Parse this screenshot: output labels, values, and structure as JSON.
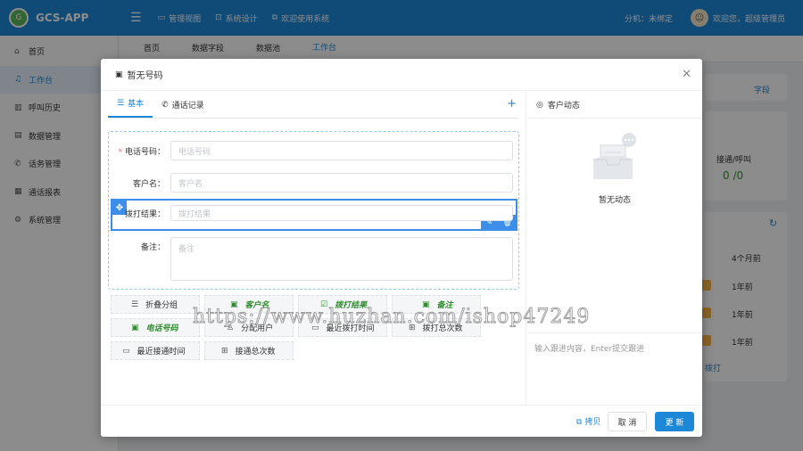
{
  "app": {
    "name": "GCS-APP",
    "logo_text": "G"
  },
  "topnav": [
    {
      "label": "管理视图",
      "icon": "monitor-icon"
    },
    {
      "label": "系统设计",
      "icon": "design-icon"
    },
    {
      "label": "欢迎使用系统",
      "icon": "copy-icon"
    }
  ],
  "topright": {
    "extension": "分机：未绑定",
    "welcome": "欢迎您，超级管理员"
  },
  "sidebar": {
    "items": [
      {
        "label": "首页",
        "icon": "home-icon"
      },
      {
        "label": "工作台",
        "icon": "headset-icon",
        "active": true
      },
      {
        "label": "呼叫历史",
        "icon": "history-icon"
      },
      {
        "label": "数据管理",
        "icon": "data-icon"
      },
      {
        "label": "话务管理",
        "icon": "phone-icon"
      },
      {
        "label": "通话报表",
        "icon": "report-icon"
      },
      {
        "label": "系统管理",
        "icon": "gear-icon"
      }
    ]
  },
  "page_tabs": [
    "首页",
    "数据字段",
    "数据池",
    "工作台"
  ],
  "background": {
    "fields_link": "字段",
    "connect_label": "接通/呼叫",
    "connect_value": "0 /0",
    "col_header": "4个月前",
    "rows": [
      "1年前",
      "1年前",
      "1年前"
    ],
    "dial_link": "拨打"
  },
  "modal": {
    "title": "暂无号码",
    "tabs": [
      "基本",
      "通话记录"
    ],
    "fields": {
      "phone": {
        "label": "电话号码：",
        "placeholder": "电话号码",
        "required": "*"
      },
      "name": {
        "label": "客户名：",
        "placeholder": "客户名"
      },
      "result": {
        "label": "拨打结果：",
        "placeholder": "拨打结果"
      },
      "note": {
        "label": "备注：",
        "placeholder": "备注"
      }
    },
    "palette": [
      {
        "label": "折叠分组",
        "icon": "collapse-icon",
        "green": false
      },
      {
        "label": "客户名",
        "icon": "field-icon",
        "green": true
      },
      {
        "label": "拨打结果",
        "icon": "checkbox-icon",
        "green": true
      },
      {
        "label": "备注",
        "icon": "field-icon",
        "green": true
      },
      {
        "label": "电话号码",
        "icon": "field-icon",
        "green": true
      },
      {
        "label": "分配用户",
        "icon": "user-icon",
        "green": false
      },
      {
        "label": "最近拨打时间",
        "icon": "calendar-icon",
        "green": false
      },
      {
        "label": "拨打总次数",
        "icon": "number-icon",
        "green": false
      },
      {
        "label": "最近接通时间",
        "icon": "calendar-icon",
        "green": false
      },
      {
        "label": "接通总次数",
        "icon": "number-icon",
        "green": false
      }
    ],
    "dynamics": {
      "title": "客户动态",
      "empty": "暂无动态",
      "input_placeholder": "输入跟进内容，Enter提交跟进"
    },
    "footer": {
      "copy": "拷贝",
      "cancel": "取 消",
      "update": "更 新"
    }
  },
  "watermark": "https://www.huzhan.com/ishop47249"
}
